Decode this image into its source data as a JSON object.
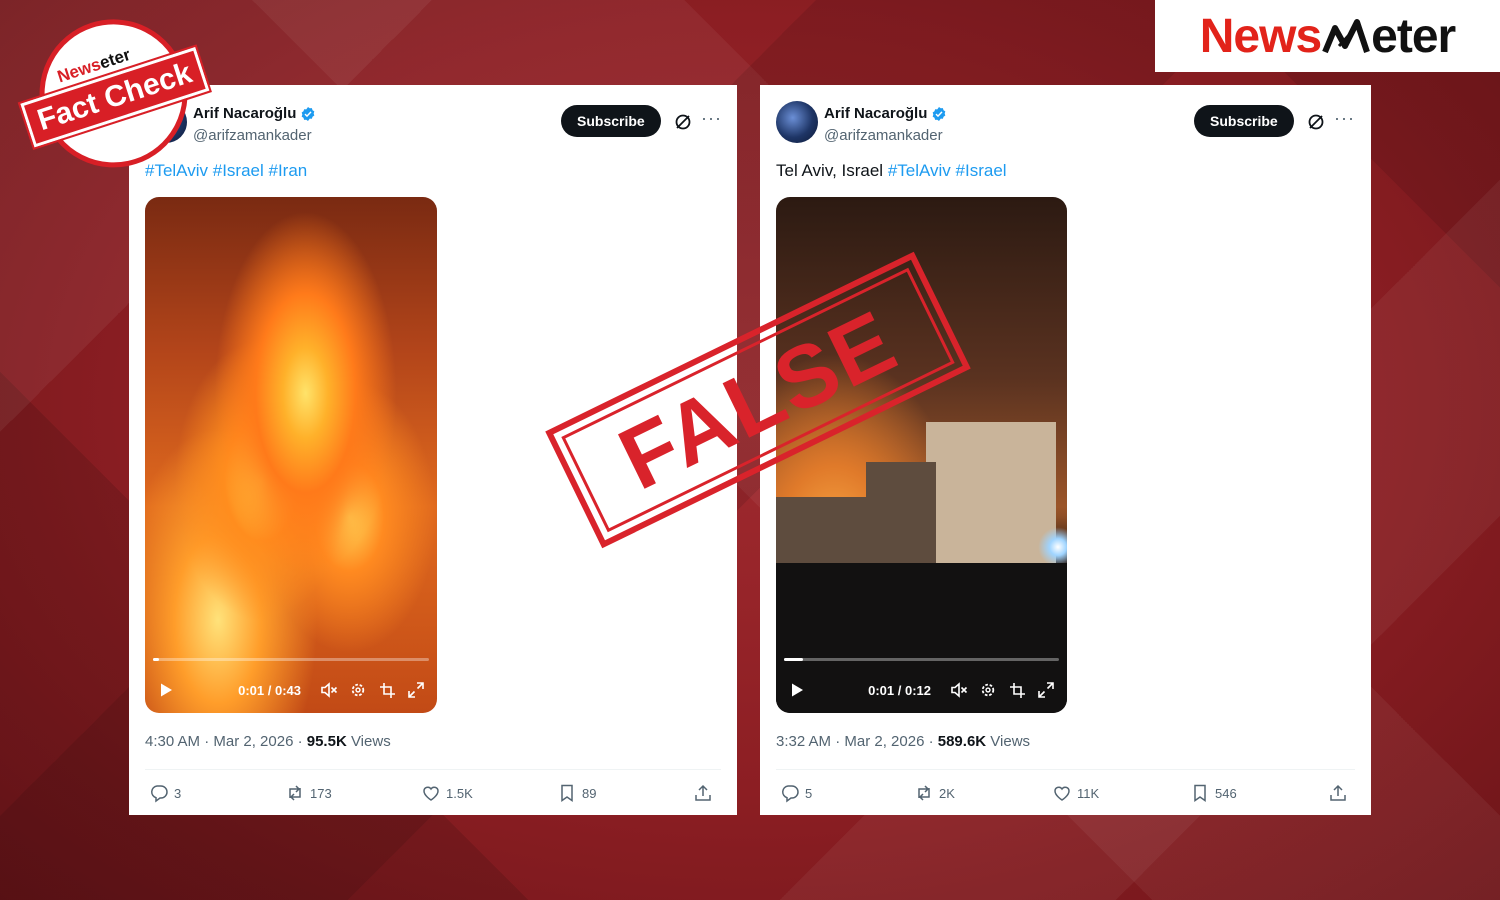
{
  "brand": {
    "logo_news": "News",
    "logo_meter": "eter",
    "badge_top_news": "News",
    "badge_top_meter": "eter",
    "badge_label": "Fact Check",
    "stamp_label": "FALSE",
    "accent_red": "#e2231a"
  },
  "tweets": [
    {
      "author": "Arif Nacaroğlu",
      "handle": "@arifzamankader",
      "subscribe_label": "Subscribe",
      "text_prefix": "",
      "hashtags": [
        "#TelAviv",
        "#Israel",
        "#Iran"
      ],
      "video_time": "0:01 / 0:43",
      "video_progress": 0.02,
      "timestamp": "4:30 AM · Mar 2, 2026 · ",
      "views_count": "95.5K",
      "views_label": " Views",
      "replies": "3",
      "reposts": "173",
      "likes": "1.5K",
      "bookmarks": "89"
    },
    {
      "author": "Arif Nacaroğlu",
      "handle": "@arifzamankader",
      "subscribe_label": "Subscribe",
      "text_prefix": "Tel Aviv, Israel ",
      "hashtags": [
        "#TelAviv",
        "#Israel"
      ],
      "video_time": "0:01 / 0:12",
      "video_progress": 0.07,
      "timestamp": "3:32 AM · Mar 2, 2026 · ",
      "views_count": "589.6K",
      "views_label": " Views",
      "replies": "5",
      "reposts": "2K",
      "likes": "11K",
      "bookmarks": "546"
    }
  ]
}
